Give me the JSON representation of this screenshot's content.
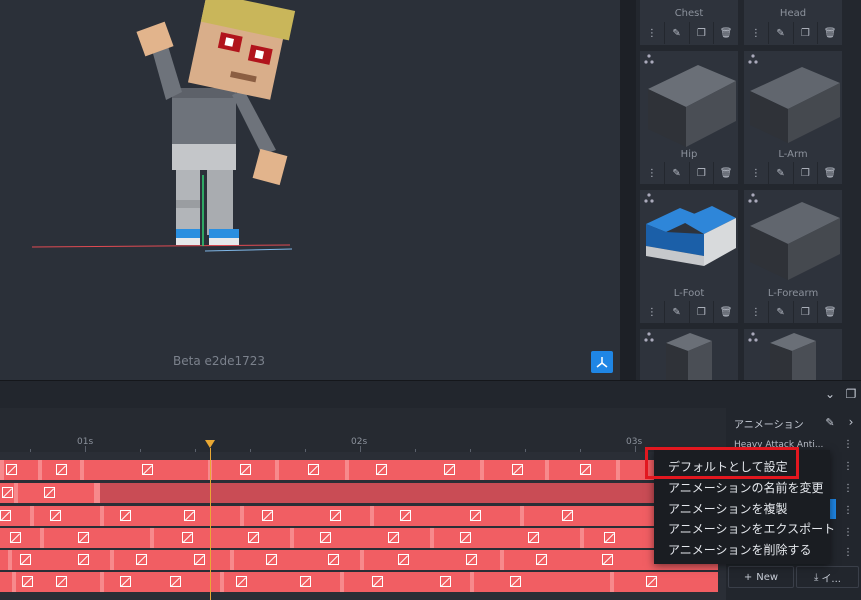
{
  "viewport": {
    "version_label": "Beta e2de1723"
  },
  "parts": {
    "items": [
      {
        "label": "Chest"
      },
      {
        "label": "Head"
      },
      {
        "label": "Hip"
      },
      {
        "label": "L-Arm"
      },
      {
        "label": "L-Foot"
      },
      {
        "label": "L-Forearm"
      },
      {
        "label": ""
      },
      {
        "label": ""
      }
    ],
    "tool_icons": [
      "more-vertical-icon",
      "edit-icon",
      "duplicate-icon",
      "trash-icon"
    ]
  },
  "timeline": {
    "ruler_labels": [
      "01s",
      "02s",
      "03s"
    ]
  },
  "animation_panel": {
    "title": "アニメーション",
    "items": [
      {
        "name": "Heavy Attack Anti..."
      },
      {
        "name": ""
      },
      {
        "name": ""
      },
      {
        "name": ""
      },
      {
        "name": ""
      },
      {
        "name": ""
      }
    ],
    "new_label": "New",
    "import_label": "イ..."
  },
  "context_menu": {
    "items": [
      {
        "label": "デフォルトとして設定"
      },
      {
        "label": "アニメーションの名前を変更"
      },
      {
        "label": "アニメーションを複製"
      },
      {
        "label": "アニメーションをエクスポート"
      },
      {
        "label": "アニメーションを削除する"
      }
    ]
  },
  "colors": {
    "accent": "#1f86e5",
    "track": "#f15e63",
    "playhead": "#e9a834",
    "highlight": "#e2171f"
  }
}
